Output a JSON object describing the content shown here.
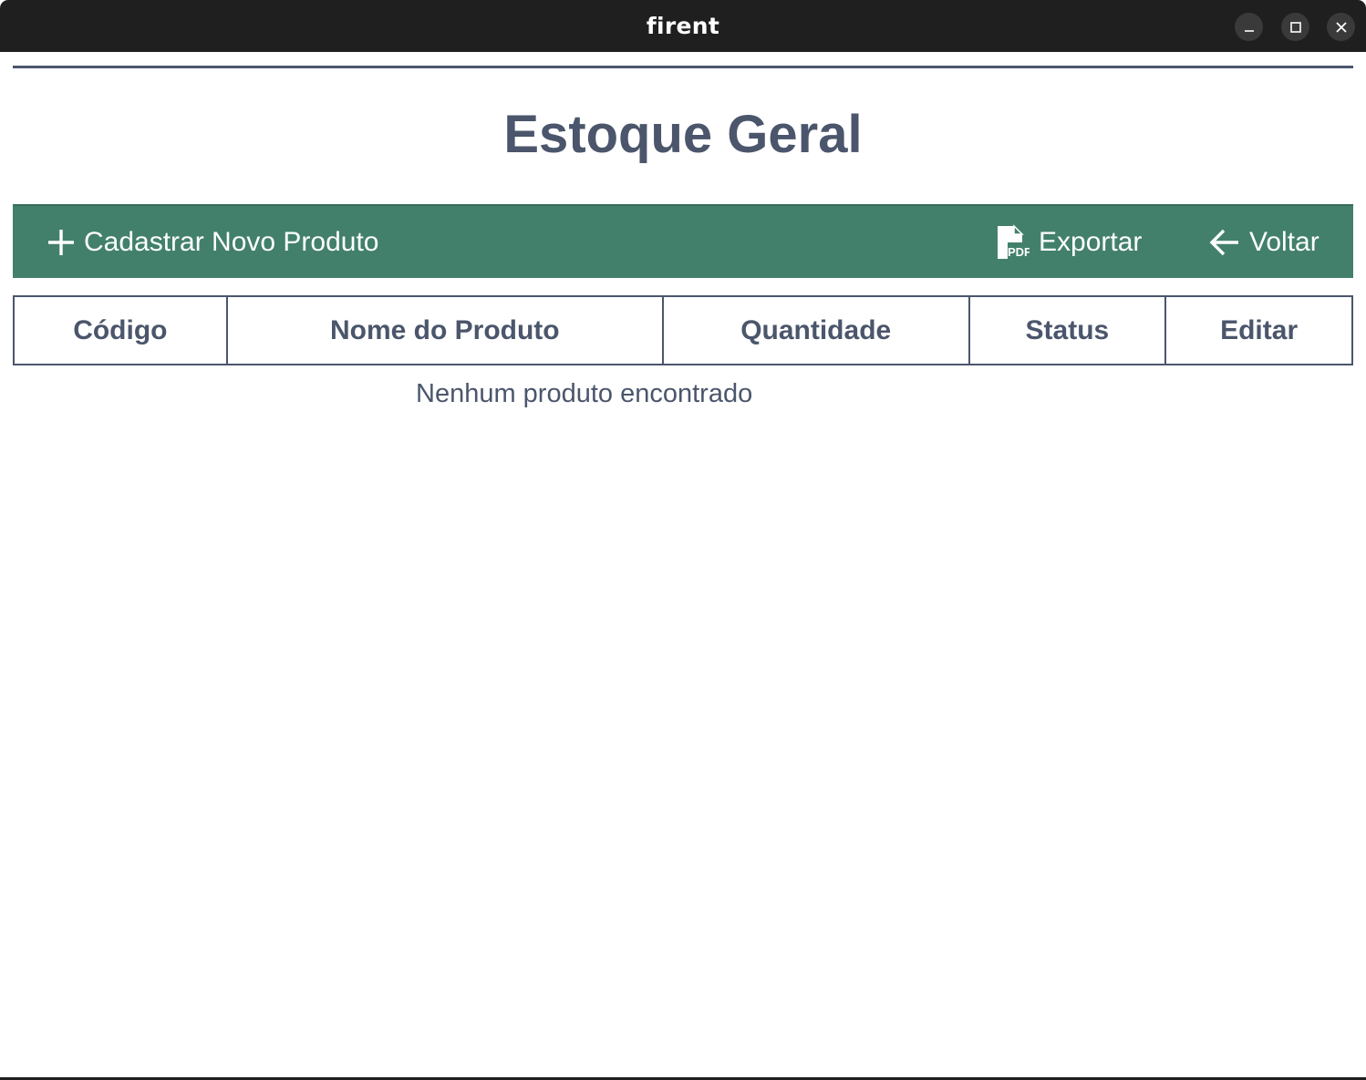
{
  "window": {
    "title": "firent"
  },
  "page": {
    "title": "Estoque Geral"
  },
  "toolbar": {
    "new_label": "Cadastrar Novo Produto",
    "new_icon": "plus-icon",
    "export_label": "Exportar",
    "export_icon": "pdf-file-icon",
    "back_label": "Voltar",
    "back_icon": "arrow-left-icon",
    "color": "#42806c"
  },
  "table": {
    "headers": [
      "Código",
      "Nome do Produto",
      "Quantidade",
      "Status",
      "Editar"
    ],
    "rows": [],
    "empty_message": "Nenhum produto encontrado"
  },
  "colors": {
    "text": "#4b566c",
    "titlebar": "#1f1f1f"
  }
}
